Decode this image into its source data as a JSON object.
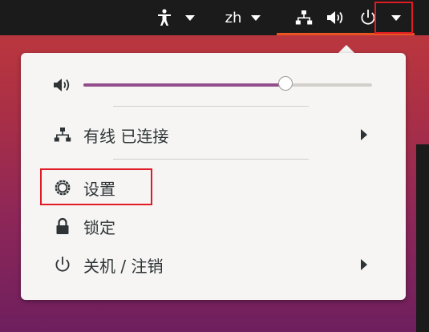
{
  "topbar": {
    "language": "zh",
    "icons": [
      "accessibility-icon",
      "language-dropdown",
      "network-wired-icon",
      "volume-icon",
      "power-icon",
      "system-menu-arrow"
    ]
  },
  "menu": {
    "volume": {
      "level": 0.7
    },
    "network": {
      "label": "有线 已连接"
    },
    "settings": {
      "label": "设置"
    },
    "lock": {
      "label": "锁定"
    },
    "power": {
      "label": "关机 / 注销"
    }
  },
  "colors": {
    "accent": "#924d8b",
    "topbar_active": "#e95420",
    "highlight_box": "#e01b24"
  }
}
